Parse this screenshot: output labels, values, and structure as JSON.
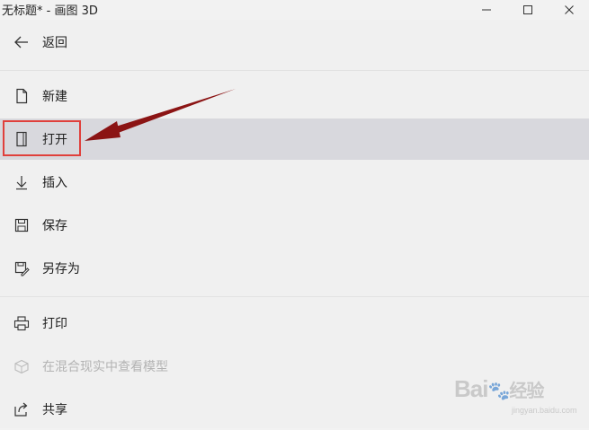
{
  "window": {
    "title": "无标题* - 画图 3D",
    "minimize_icon": "minimize-icon",
    "maximize_icon": "maximize-icon",
    "close_icon": "close-icon"
  },
  "menu": {
    "back": {
      "label": "返回",
      "icon": "back-arrow-icon"
    },
    "items": [
      {
        "label": "新建",
        "icon": "new-file-icon"
      },
      {
        "label": "打开",
        "icon": "open-file-icon",
        "selected": true
      },
      {
        "label": "插入",
        "icon": "insert-icon"
      },
      {
        "label": "保存",
        "icon": "save-icon"
      },
      {
        "label": "另存为",
        "icon": "save-as-icon"
      },
      {
        "label": "打印",
        "icon": "print-icon"
      },
      {
        "label": "在混合现实中查看模型",
        "icon": "mixed-reality-icon",
        "disabled": true
      },
      {
        "label": "共享",
        "icon": "share-icon"
      }
    ]
  },
  "annotation": {
    "highlight_color": "#e0403c",
    "arrow_color": "#8b1414"
  },
  "watermark": {
    "brand_a": "Bai",
    "brand_b": "经验",
    "sub": "jingyan.baidu.com"
  }
}
